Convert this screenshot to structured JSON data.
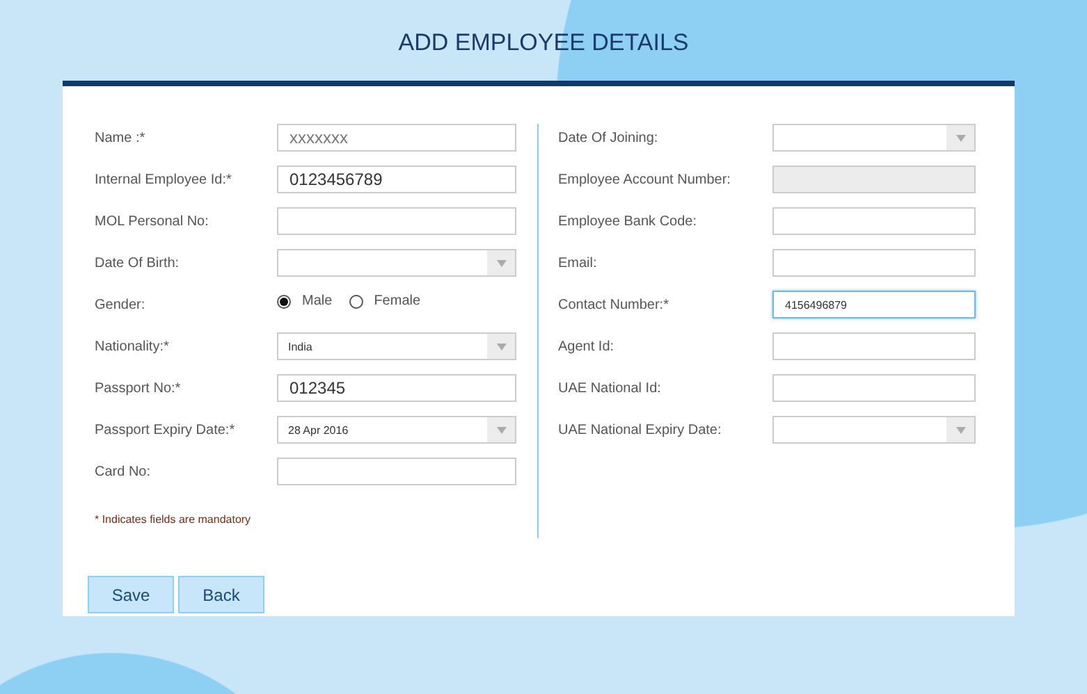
{
  "title": "ADD EMPLOYEE DETAILS",
  "left_fields": [
    {
      "label": "Name :*",
      "kind": "text",
      "placeholder": "xxxxxxx"
    },
    {
      "label": "Internal Employee Id:*",
      "kind": "text",
      "value": "0123456789"
    },
    {
      "label": "MOL Personal No:",
      "kind": "text"
    },
    {
      "label": "Date Of Birth:",
      "kind": "select"
    },
    {
      "label": "Gender:",
      "kind": "radio",
      "options": [
        {
          "label": "Male",
          "selected": true
        },
        {
          "label": "Female",
          "selected": false
        }
      ]
    },
    {
      "label": "Nationality:*",
      "kind": "select",
      "value": "India"
    },
    {
      "label": "Passport No:*",
      "kind": "text",
      "value": "012345"
    },
    {
      "label": "Passport Expiry Date:*",
      "kind": "select",
      "value": "28 Apr 2016"
    },
    {
      "label": "Card No:",
      "kind": "text"
    }
  ],
  "note": "* Indicates fields are mandatory",
  "right_fields": [
    {
      "label": "Date Of Joining:",
      "kind": "select"
    },
    {
      "label": "Employee Account Number:",
      "kind": "text",
      "disabled": true
    },
    {
      "label": "Employee Bank Code:",
      "kind": "text"
    },
    {
      "label": "Email:",
      "kind": "text"
    },
    {
      "label": "Contact Number:*",
      "kind": "text",
      "value": "4156496879",
      "focused": true
    },
    {
      "label": "Agent Id:",
      "kind": "text"
    },
    {
      "label": "UAE National Id:",
      "kind": "text"
    },
    {
      "label": "UAE National Expiry Date:",
      "kind": "select"
    }
  ],
  "buttons": [
    "Save",
    "Back"
  ]
}
